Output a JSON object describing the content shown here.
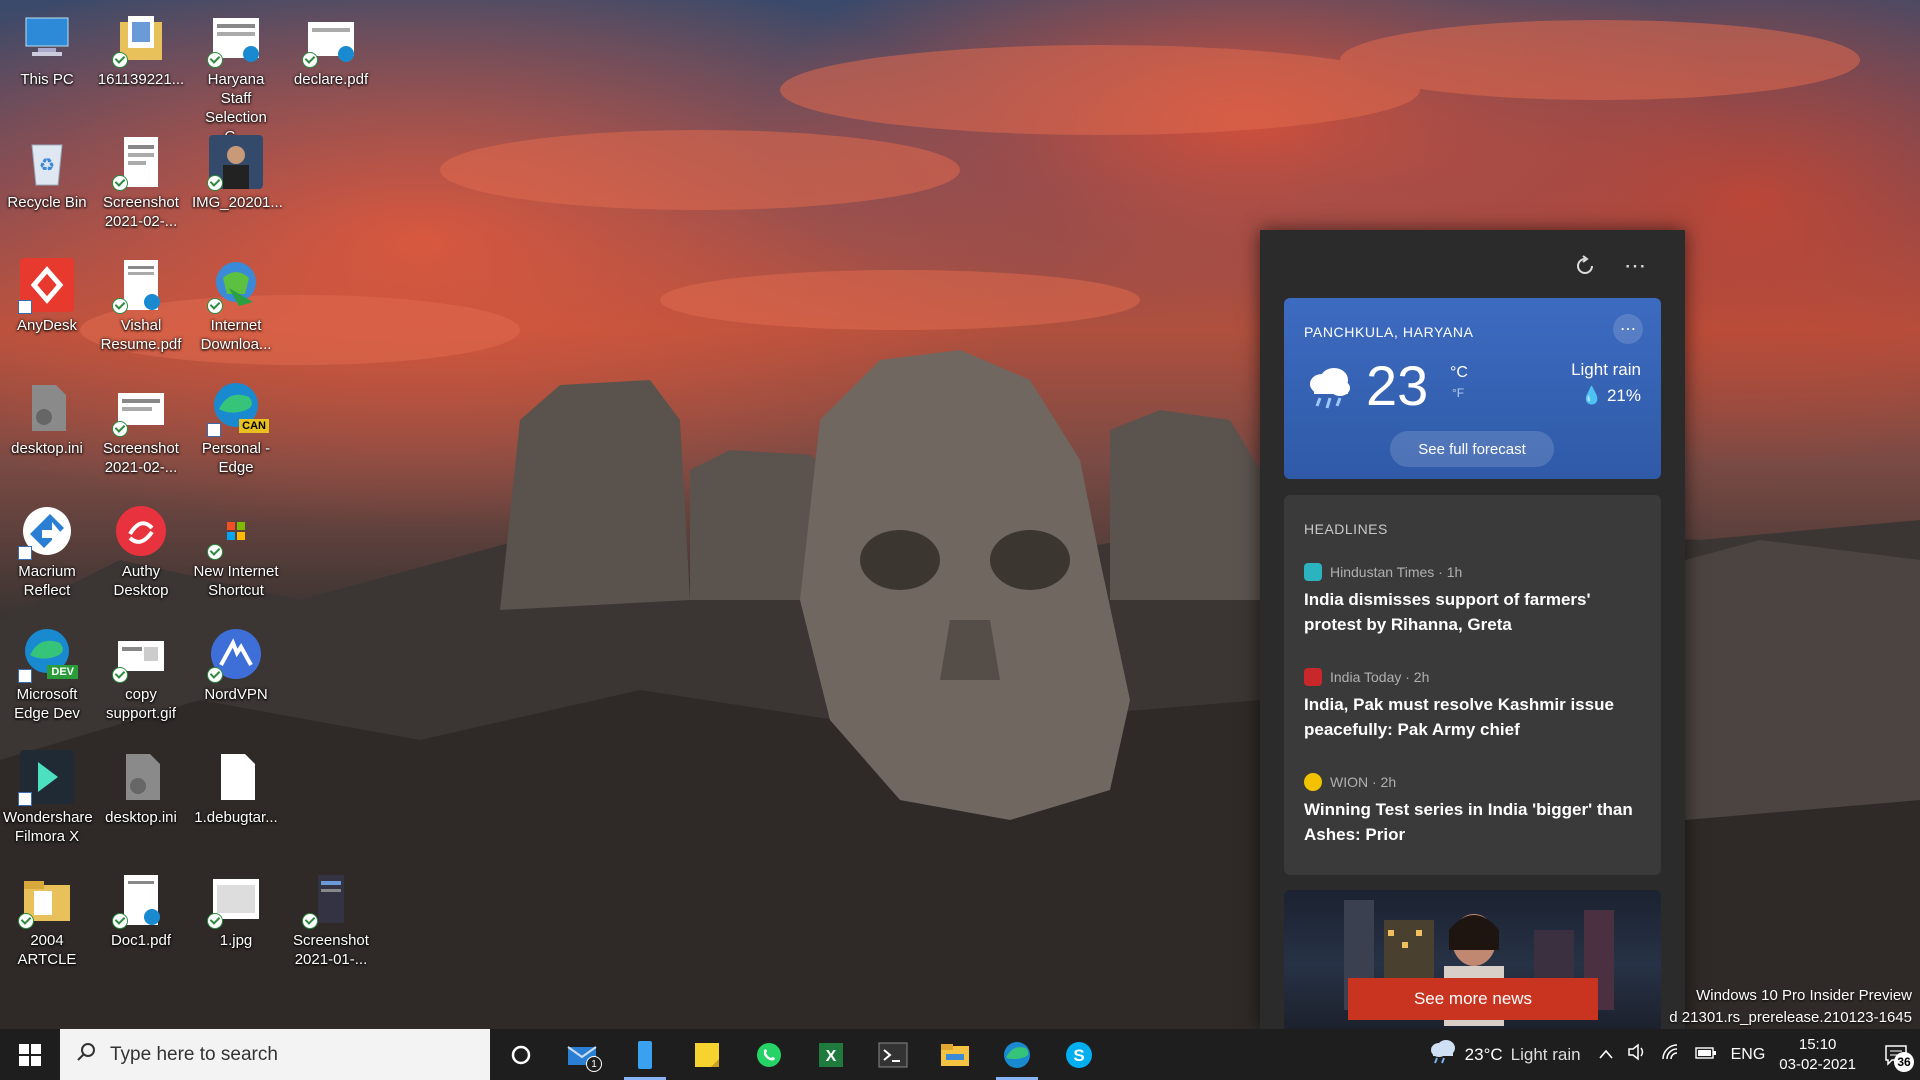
{
  "desktop": {
    "icons": [
      {
        "label": "This PC"
      },
      {
        "label": "161139221..."
      },
      {
        "label": "Haryana Staff Selection C..."
      },
      {
        "label": "declare.pdf"
      },
      {
        "label": "Recycle Bin"
      },
      {
        "label": "Screenshot 2021-02-..."
      },
      {
        "label": "IMG_20201..."
      },
      {
        "label": "AnyDesk"
      },
      {
        "label": "Vishal Resume.pdf"
      },
      {
        "label": "Internet Downloa..."
      },
      {
        "label": "desktop.ini"
      },
      {
        "label": "Screenshot 2021-02-..."
      },
      {
        "label": "Personal - Edge"
      },
      {
        "label": "Macrium Reflect"
      },
      {
        "label": "Authy Desktop"
      },
      {
        "label": "New Internet Shortcut"
      },
      {
        "label": "Microsoft Edge Dev"
      },
      {
        "label": "copy support.gif"
      },
      {
        "label": "NordVPN"
      },
      {
        "label": "Wondershare Filmora X"
      },
      {
        "label": "desktop.ini"
      },
      {
        "label": "1.debugtar..."
      },
      {
        "label": "2004 ARTCLE"
      },
      {
        "label": "Doc1.pdf"
      },
      {
        "label": "1.jpg"
      },
      {
        "label": "Screenshot 2021-01-..."
      }
    ],
    "badges": {
      "dev": "DEV",
      "can": "CAN"
    }
  },
  "news": {
    "weather": {
      "location": "PANCHKULA, HARYANA",
      "temperature": "23",
      "unit_c": "°C",
      "unit_f": "°F",
      "condition": "Light rain",
      "precipitation": "21%",
      "forecast_button": "See full forecast",
      "icon": "rain-cloud-icon"
    },
    "headlines_title": "HEADLINES",
    "stories": [
      {
        "source": "Hindustan Times · 1h",
        "headline": "India dismisses support of farmers' protest by Rihanna, Greta",
        "logo_color": "#2bb3c0"
      },
      {
        "source": "India Today · 2h",
        "headline": "India, Pak must resolve Kashmir issue peacefully: Pak Army chief",
        "logo_color": "#c8282a"
      },
      {
        "source": "WION · 2h",
        "headline": "Winning Test series in India 'bigger' than Ashes: Prior",
        "logo_color": "#f2c200"
      }
    ],
    "see_more": "See more news"
  },
  "watermark": {
    "line1": "Windows 10 Pro Insider Preview",
    "line2": "d 21301.rs_prerelease.210123-1645"
  },
  "taskbar": {
    "search_placeholder": "Type here to search",
    "mail_badge": "1",
    "pinned": [
      "cortana-icon",
      "mail-icon",
      "phone-icon",
      "sticky-notes-icon",
      "whatsapp-icon",
      "excel-icon",
      "terminal-icon",
      "file-explorer-icon",
      "edge-dev-icon",
      "skype-icon"
    ],
    "tray_weather": {
      "temp": "23°C",
      "condition": "Light rain"
    },
    "language": "ENG",
    "time": "15:10",
    "date": "03-02-2021",
    "notifications": "36"
  },
  "colors": {
    "weather_card": "#3562b5",
    "see_more": "#c8341f",
    "taskbar": "#1e1e1e"
  }
}
